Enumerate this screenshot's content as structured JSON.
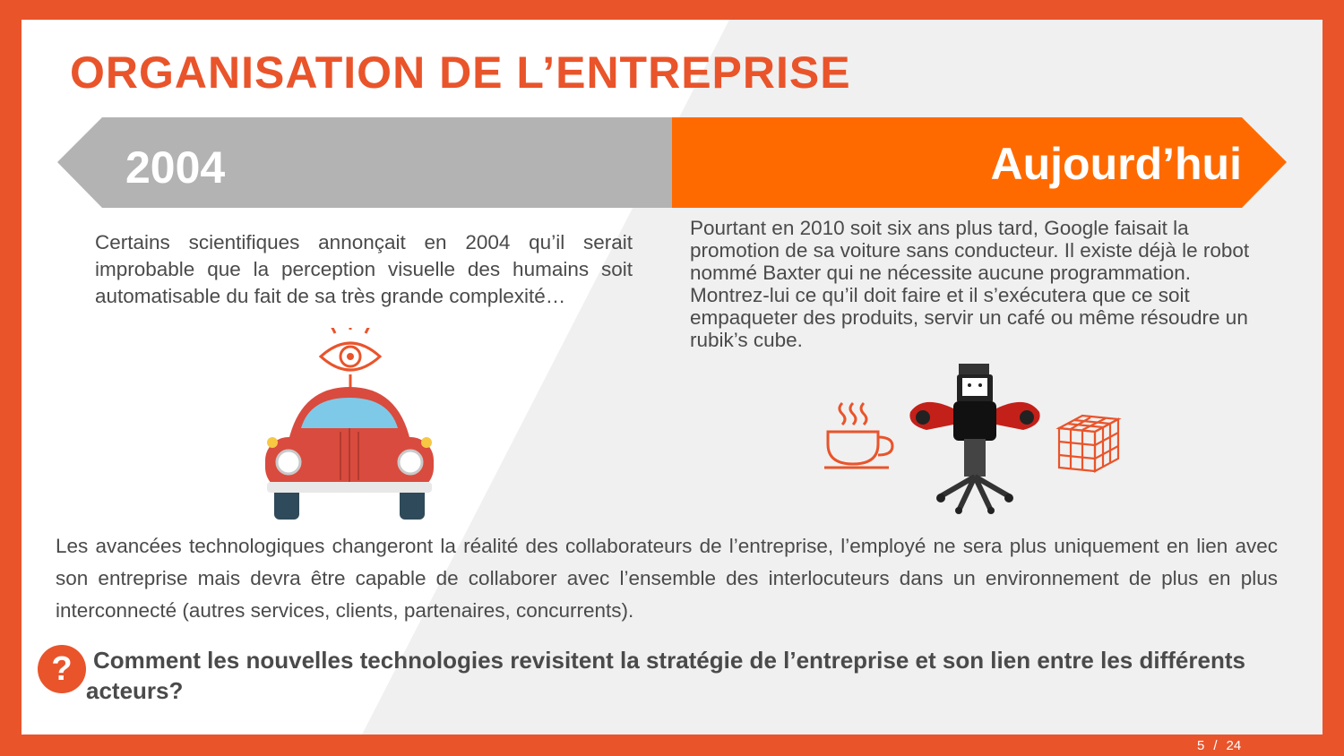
{
  "title": "ORGANISATION DE L’ENTREPRISE",
  "timeline": {
    "left_label": "2004",
    "right_label": "Aujourd’hui"
  },
  "left_text": "Certains scientifiques annonçait en 2004 qu’il serait improbable que la perception visuelle des humains soit automatisable du fait de sa très grande complexité…",
  "right_text": "Pourtant en 2010 soit six ans plus tard, Google faisait la promotion de sa voiture sans conducteur. Il existe déjà le robot nommé Baxter qui ne nécessite aucune programmation. Montrez-lui ce qu’il doit faire et il s’exécutera que ce soit empaqueter des produits, servir un café ou même résoudre un rubik’s cube.",
  "paragraph": "Les avancées technologiques changeront la réalité des collaborateurs de l’entreprise, l’employé ne sera plus uniquement en lien avec son entreprise mais devra être capable de collaborer avec l’ensemble des interlocuteurs dans un environnement de plus en plus interconnecté (autres services, clients, partenaires, concurrents).",
  "question": {
    "symbol": "?",
    "text": "Comment les nouvelles technologies revisitent la stratégie de l’entreprise et son lien entre les différents acteurs?"
  },
  "pagination": {
    "current": "5",
    "separator": "/",
    "total": "24"
  },
  "colors": {
    "accent": "#e9542b",
    "orange": "#ff6a00",
    "grey_banner": "#b3b3b3",
    "text": "#4a4a4a"
  },
  "icons": [
    "eye-icon",
    "car-icon",
    "robot-image",
    "coffee-cup-icon",
    "rubiks-cube-icon",
    "question-icon"
  ]
}
